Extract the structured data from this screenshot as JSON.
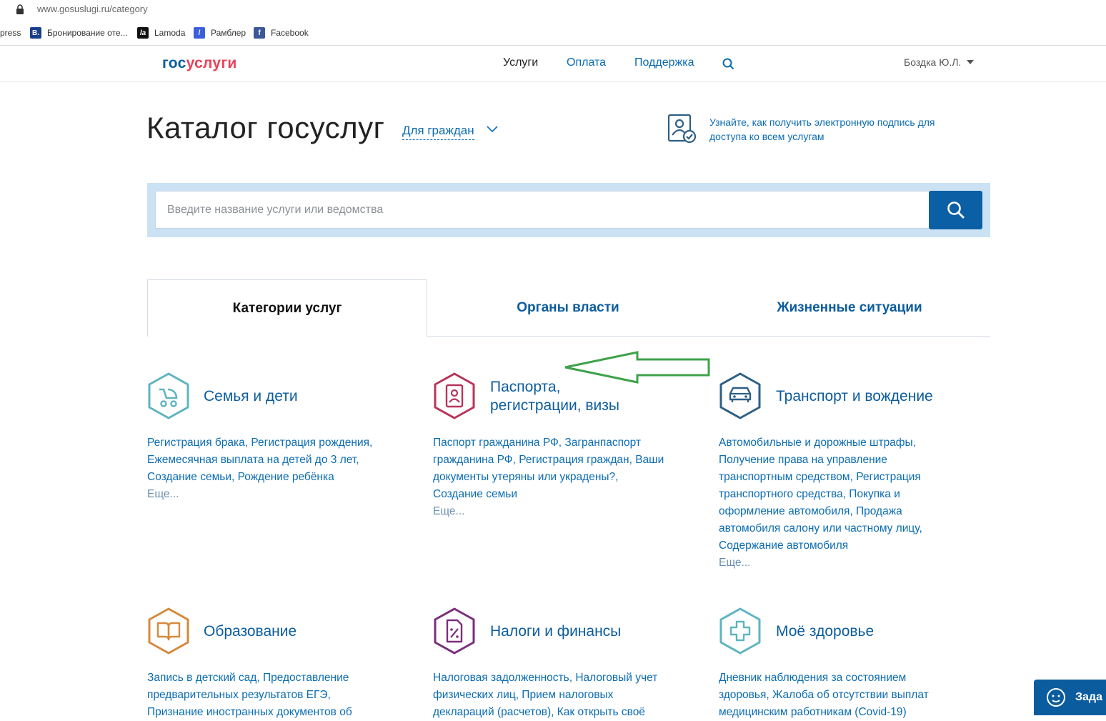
{
  "browser": {
    "url": "www.gosuslugi.ru/category",
    "bookmarks": [
      {
        "label": "xpress",
        "icon": "express-icon"
      },
      {
        "label": "Бронирование оте...",
        "icon": "booking-icon",
        "glyph": "B."
      },
      {
        "label": "Lamoda",
        "icon": "lamoda-icon",
        "glyph": "la"
      },
      {
        "label": "Рамблер",
        "icon": "rambler-icon",
        "glyph": "/"
      },
      {
        "label": "Facebook",
        "icon": "facebook-icon",
        "glyph": "f"
      }
    ]
  },
  "header": {
    "logo_part1": "гос",
    "logo_part2": "услуги",
    "nav": [
      "Услуги",
      "Оплата",
      "Поддержка"
    ],
    "user": "Боздка Ю.Л."
  },
  "catalog": {
    "title": "Каталог госуслуг",
    "audience": "Для граждан",
    "sign_text": "Узнайте, как получить электронную подпись для доступа ко всем услугам"
  },
  "search": {
    "placeholder": "Введите название услуги или ведомства"
  },
  "tabs": [
    "Категории услуг",
    "Органы власти",
    "Жизненные ситуации"
  ],
  "categories": [
    {
      "title": "Семья и дети",
      "desc": "Регистрация брака, Регистрация рождения, Ежемесячная выплата на детей до 3 лет, Создание семьи, Рождение ребёнка",
      "more": "Еще...",
      "color": "#5fb4c0"
    },
    {
      "title": "Паспорта, регистрации, визы",
      "title_l1": "Паспорта,",
      "title_l2": "регистрации, визы",
      "desc": "Паспорт гражданина РФ, Загранпаспорт гражданина РФ, Регистрация граждан, Ваши документы утеряны или украдены?, Создание семьи",
      "more": "Еще...",
      "color": "#b8345a"
    },
    {
      "title": "Транспорт и вождение",
      "desc": "Автомобильные и дорожные штрафы, Получение права на управление транспортным средством, Регистрация транспортного средства, Покупка и оформление автомобиля, Продажа автомобиля салону или частному лицу, Содержание автомобиля",
      "more": "Еще...",
      "color": "#2e5f86"
    },
    {
      "title": "Образование",
      "desc": "Запись в детский сад, Предоставление предварительных результатов ЕГЭ, Признание иностранных документов об",
      "color": "#d58a3a"
    },
    {
      "title": "Налоги и финансы",
      "desc": "Налоговая задолженность, Налоговый учет физических лиц, Прием налоговых деклараций (расчетов), Как открыть своё",
      "color": "#7a2e7c"
    },
    {
      "title": "Моё здоровье",
      "desc": "Дневник наблюдения за состоянием здоровья, Жалоба об отсутствии выплат медицинским работникам (Covid-19)",
      "color": "#5fb4c0"
    }
  ],
  "help": {
    "label": "Зада"
  }
}
